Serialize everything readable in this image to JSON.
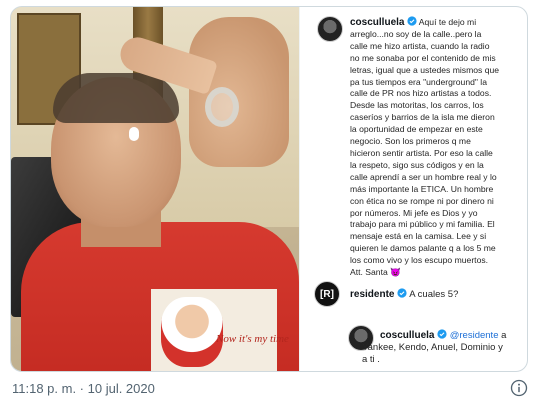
{
  "post": {
    "author": "cosculluela",
    "caption": "Aquí te dejo mi arreglo...no soy de la calle..pero la calle me hizo artista, cuando la radio no me sonaba por el contenido de mis letras, igual que a ustedes mismos que pa tus tiempos era \"underground\" la calle de PR nos hizo artistas a todos. Desde las motoritas, los carros, los caseríos y barrios de la isla me dieron la oportunidad de empezar en este negocio. Son los primeros q me hicieron sentir artista. Por eso la calle la respeto, sigo sus códigos y en la calle aprendí a ser un hombre real y lo más importante la ETICA. Un hombre con ética no se rompe ni por dinero ni por números. Mi jefe es Dios y yo trabajo para mi público y mi familia. El mensaje está en la camisa. Lee y si quieren le damos palante q a los 5 me los como vivo y los escupo muertos. Att. Santa 😈",
    "caption_lines": [
      "Aquí te dejo mi",
      "arreglo...no soy de la calle..pero la",
      "calle me hizo artista, cuando la radio",
      "no me sonaba por el contenido de mis",
      "letras, igual que a ustedes mismos que",
      "pa tus tiempos era \"underground\" la",
      "calle de PR nos hizo artistas a todos.",
      "Desde las motoritas, los carros, los",
      "caseríos y barrios de la isla me dieron",
      "la oportunidad de empezar en este",
      "negocio. Son los primeros q me",
      "hicieron sentir artista. Por eso la calle",
      "la respeto, sigo sus códigos y en la",
      "calle aprendí a ser un hombre real y lo",
      "más importante la ETICA. Un hombre",
      "con ética no se rompe ni por dinero ni",
      "por números. Mi jefe es Dios y yo",
      "trabajo para mi público y mi familia. El",
      "mensaje está en la camisa. Lee y si",
      "quieren le damos palante q a los 5 me",
      "los como vivo y los escupo muertos.",
      "Att. Santa 😈"
    ],
    "shirt_print_text": "Now it's my time"
  },
  "comments": [
    {
      "author": "residente",
      "avatar_text": "[R]",
      "text": "A cuales 5?"
    },
    {
      "author": "cosculluela",
      "mention": "@residente",
      "text_after_mention": " a",
      "lines": [
        "Yankee, Kendo, Anuel, Dominio y",
        "a ti ."
      ]
    }
  ],
  "tweet": {
    "timestamp": "11:18 p. m. · 10 jul. 2020"
  },
  "colors": {
    "verified": "#1d9bf0",
    "mention": "#1d6fd6",
    "border": "#cfd9de",
    "muted": "#536471"
  }
}
